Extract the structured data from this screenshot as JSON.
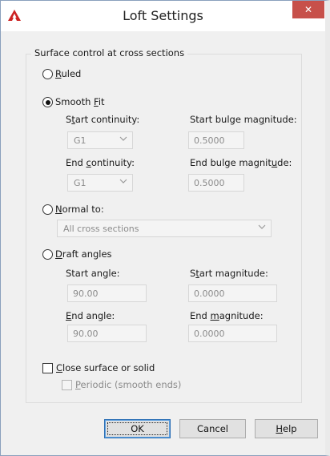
{
  "window": {
    "title": "Loft Settings",
    "close_glyph": "✕",
    "app_icon": "autocad-icon",
    "accent_colors": {
      "close": "#c7504a",
      "app_icon": "#cc2222"
    }
  },
  "group": {
    "legend": "Surface control at cross sections"
  },
  "options": {
    "ruled": {
      "pre": "",
      "key": "R",
      "post": "uled",
      "selected": false
    },
    "smooth_fit": {
      "pre": "Smooth ",
      "key": "F",
      "post": "it",
      "selected": true
    },
    "normal_to": {
      "pre": "",
      "key": "N",
      "post": "ormal to:",
      "selected": false
    },
    "draft_angles": {
      "pre": "",
      "key": "D",
      "post": "raft angles",
      "selected": false
    }
  },
  "smooth": {
    "start_cont_label": {
      "pre": "S",
      "key": "t",
      "post": "art continuity:"
    },
    "start_cont_value": "G1",
    "start_bulge_label": {
      "pre": "Start bulge ma",
      "key": "g",
      "post": "nitude:"
    },
    "start_bulge_value": "0.5000",
    "end_cont_label": {
      "pre": "End ",
      "key": "c",
      "post": "ontinuity:"
    },
    "end_cont_value": "G1",
    "end_bulge_label": {
      "pre": "End bulge magnit",
      "key": "u",
      "post": "de:"
    },
    "end_bulge_value": "0.5000"
  },
  "normal": {
    "value": "All cross sections"
  },
  "draft": {
    "start_angle_label": "Start angle:",
    "start_angle_value": "90.00",
    "start_mag_label": {
      "pre": "S",
      "key": "t",
      "post": "art magnitude:"
    },
    "start_mag_value": "0.0000",
    "end_angle_label": {
      "pre": "",
      "key": "E",
      "post": "nd angle:"
    },
    "end_angle_value": "90.00",
    "end_mag_label": {
      "pre": "End ",
      "key": "m",
      "post": "agnitude:"
    },
    "end_mag_value": "0.0000"
  },
  "close_surface": {
    "label": {
      "pre": "",
      "key": "C",
      "post": "lose surface or solid"
    },
    "checked": false
  },
  "periodic": {
    "label": {
      "pre": "",
      "key": "P",
      "post": "eriodic (smooth ends)"
    },
    "checked": false,
    "enabled": false
  },
  "buttons": {
    "ok": "OK",
    "cancel": "Cancel",
    "help": {
      "pre": "",
      "key": "H",
      "post": "elp"
    }
  }
}
